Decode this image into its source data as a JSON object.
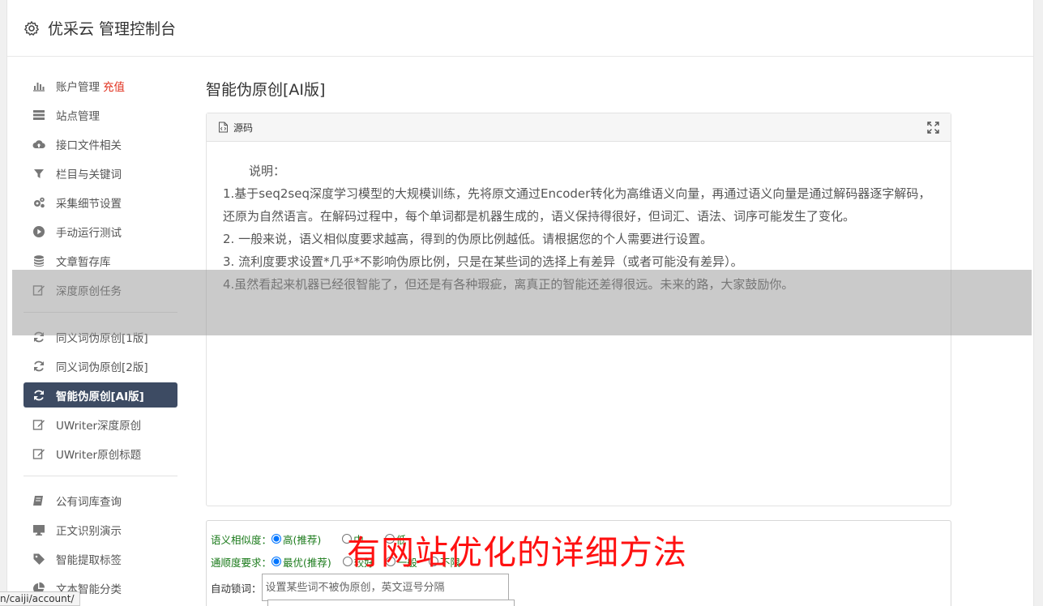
{
  "header": {
    "title": "优采云 管理控制台"
  },
  "sidebar": {
    "group1": [
      {
        "label": "账户管理",
        "extra": "充值",
        "icon": "bar-chart-icon"
      },
      {
        "label": "站点管理",
        "icon": "server-icon"
      },
      {
        "label": "接口文件相关",
        "icon": "cloud-upload-icon"
      },
      {
        "label": "栏目与关键词",
        "icon": "filter-icon"
      },
      {
        "label": "采集细节设置",
        "icon": "gears-icon"
      },
      {
        "label": "手动运行测试",
        "icon": "play-circle-icon"
      },
      {
        "label": "文章暂存库",
        "icon": "database-icon"
      },
      {
        "label": "深度原创任务",
        "icon": "edit-icon"
      }
    ],
    "group2": [
      {
        "label": "同义词伪原创[1版]",
        "icon": "refresh-icon"
      },
      {
        "label": "同义词伪原创[2版]",
        "icon": "refresh-icon"
      },
      {
        "label": "智能伪原创[AI版]",
        "icon": "refresh-icon"
      },
      {
        "label": "UWriter深度原创",
        "icon": "edit-icon"
      },
      {
        "label": "UWriter原创标题",
        "icon": "edit-icon"
      }
    ],
    "group3": [
      {
        "label": "公有词库查询",
        "icon": "book-icon"
      },
      {
        "label": "正文识别演示",
        "icon": "desktop-icon"
      },
      {
        "label": "智能提取标签",
        "icon": "tag-icon"
      },
      {
        "label": "文本智能分类",
        "icon": "pie-chart-icon"
      }
    ]
  },
  "main": {
    "title": "智能伪原创[AI版]",
    "panel_tab": "源码",
    "intro": "说明：",
    "lines": [
      "1.基于seq2seq深度学习模型的大规模训练，先将原文通过Encoder转化为高维语义向量，再通过语义向量是通过解码器逐字解码，还原为自然语言。在解码过程中，每个单词都是机器生成的，语义保持得很好，但词汇、语法、词序可能发生了变化。",
      "2. 一般来说，语义相似度要求越高，得到的伪原比例越低。请根据您的个人需要进行设置。",
      "3. 流利度要求设置*几乎*不影响伪原比例，只是在某些词的选择上有差异（或者可能没有差异）。",
      "4.虽然看起来机器已经很智能了，但还是有各种瑕疵，离真正的智能还差得很远。未来的路，大家鼓励你。"
    ]
  },
  "form": {
    "similarity_label": "语义相似度：",
    "similarity_options": [
      "高(推荐)",
      "中",
      "低"
    ],
    "fluency_label": "通顺度要求：",
    "fluency_options": [
      "最优(推荐)",
      "较好",
      "一般",
      "不限"
    ],
    "lock_label": "自动锁词：",
    "lock_placeholder": "设置某些词不被伪原创，英文逗号分隔"
  },
  "watermark": "有网站优化的详细方法",
  "status_url": "n/caiji/account/"
}
